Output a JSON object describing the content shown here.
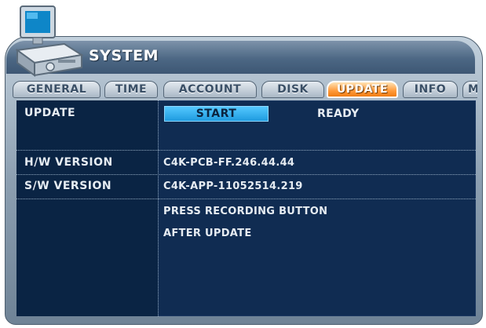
{
  "window": {
    "title": "SYSTEM"
  },
  "tabs": [
    {
      "label": "GENERAL",
      "active": false
    },
    {
      "label": "TIME",
      "active": false
    },
    {
      "label": "ACCOUNT",
      "active": false
    },
    {
      "label": "DISK",
      "active": false
    },
    {
      "label": "UPDATE",
      "active": true
    },
    {
      "label": "INFO",
      "active": false
    },
    {
      "label": "M",
      "active": false
    }
  ],
  "update": {
    "label": "UPDATE",
    "start_button": "START",
    "status": "READY"
  },
  "hw_version": {
    "label": "H/W VERSION",
    "value": "C4K-PCB-FF.246.44.44"
  },
  "sw_version": {
    "label": "S/W VERSION",
    "value": "C4K-APP-11052514.219"
  },
  "message": {
    "line1": "PRESS RECORDING BUTTON",
    "line2": "AFTER UPDATE"
  },
  "colors": {
    "panel_bg": "#102c52",
    "active_tab": "#ff9a3a",
    "start_button": "#2fb0f0",
    "titlebar": "#4c6784"
  }
}
